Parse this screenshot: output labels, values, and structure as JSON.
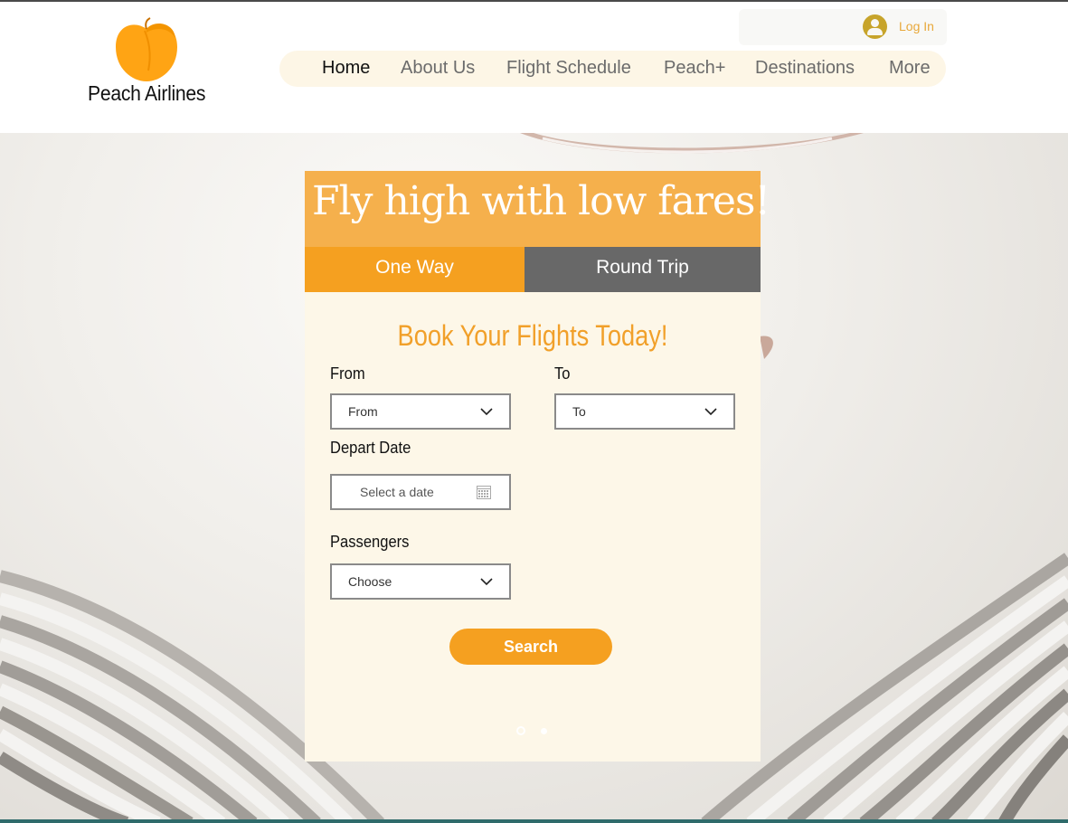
{
  "brand": {
    "name": "Peach Airlines",
    "accent": "#f5a020",
    "logo_color": "#ffa414"
  },
  "login": {
    "label": "Log In",
    "icon": "user-avatar-icon"
  },
  "nav": {
    "items": [
      {
        "label": "Home",
        "active": true
      },
      {
        "label": "About Us",
        "active": false
      },
      {
        "label": "Flight Schedule",
        "active": false
      },
      {
        "label": "Peach+",
        "active": false
      },
      {
        "label": "Destinations",
        "active": false
      },
      {
        "label": "More",
        "active": false
      }
    ]
  },
  "hero": {
    "headline": "Fly high with low fares!",
    "tabs": {
      "one_way": "One Way",
      "round_trip": "Round Trip"
    }
  },
  "booking": {
    "title": "Book Your Flights Today!",
    "from": {
      "label": "From",
      "value": "From"
    },
    "to": {
      "label": "To",
      "value": "To"
    },
    "depart": {
      "label": "Depart Date",
      "placeholder": "Select a date"
    },
    "passengers": {
      "label": "Passengers",
      "value": "Choose"
    },
    "search_label": "Search"
  },
  "slideshow": {
    "slides": 2,
    "current": 1
  }
}
